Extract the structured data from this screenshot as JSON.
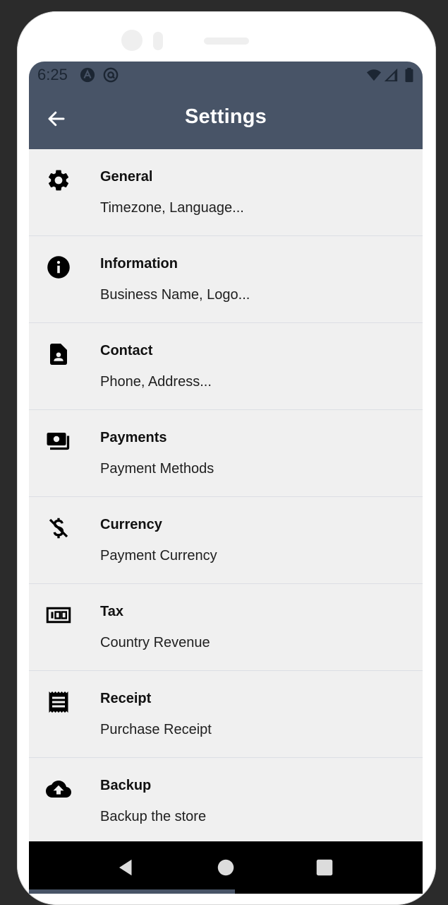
{
  "status": {
    "time": "6:25",
    "icons": [
      "app-a-icon",
      "at-sign-icon",
      "wifi-icon",
      "signal-icon",
      "battery-icon"
    ]
  },
  "header": {
    "title": "Settings",
    "back_icon": "arrow-left-icon"
  },
  "colors": {
    "appbar": "#485467",
    "background": "#f0f0f0",
    "divider": "#dcdee4"
  },
  "settings": [
    {
      "title": "General",
      "subtitle": "Timezone, Language...",
      "icon": "gear-icon"
    },
    {
      "title": "Information",
      "subtitle": "Business Name, Logo...",
      "icon": "info-icon"
    },
    {
      "title": "Contact",
      "subtitle": "Phone, Address...",
      "icon": "contact-card-icon"
    },
    {
      "title": "Payments",
      "subtitle": "Payment Methods",
      "icon": "payments-icon"
    },
    {
      "title": "Currency",
      "subtitle": "Payment Currency",
      "icon": "money-off-icon"
    },
    {
      "title": "Tax",
      "subtitle": "Country Revenue",
      "icon": "tax-100-icon"
    },
    {
      "title": "Receipt",
      "subtitle": "Purchase Receipt",
      "icon": "receipt-icon"
    },
    {
      "title": "Backup",
      "subtitle": "Backup the store",
      "icon": "cloud-upload-icon"
    }
  ],
  "navigation": {
    "buttons": [
      "back-triangle-icon",
      "home-circle-icon",
      "recents-square-icon"
    ]
  }
}
